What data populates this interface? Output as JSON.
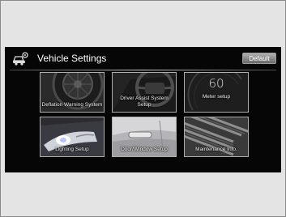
{
  "header": {
    "title": "Vehicle Settings",
    "icon": "car-settings-icon",
    "default_label": "Default"
  },
  "tiles": [
    {
      "label": "Deflation Warning System",
      "icon": "tire-icon"
    },
    {
      "label": "Driver Assist System Setup",
      "icon": "steering-wheel-icon"
    },
    {
      "label": "Meter setup",
      "icon": "speedometer-icon",
      "display_value": "60"
    },
    {
      "label": "Lighting Setup",
      "icon": "headlight-icon"
    },
    {
      "label": "Door/Window Setup",
      "icon": "door-handle-icon"
    },
    {
      "label": "Maintenance Info.",
      "icon": "engine-icon"
    }
  ]
}
